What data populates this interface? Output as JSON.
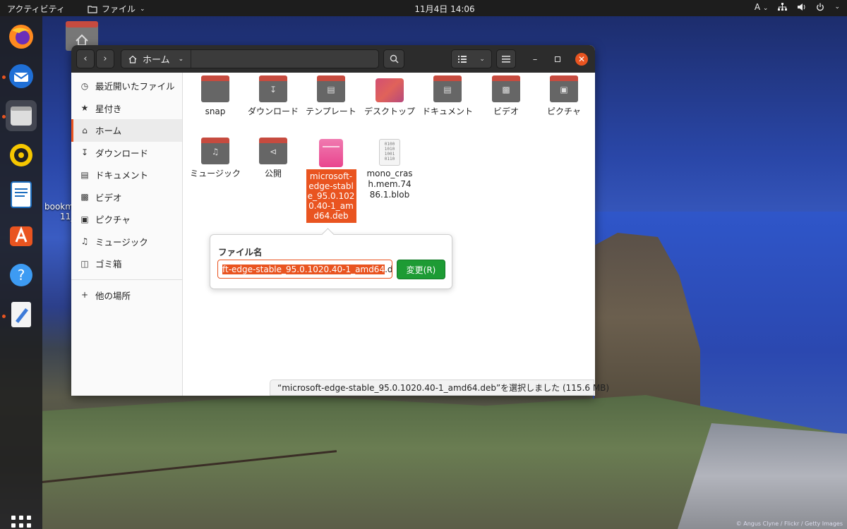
{
  "topbar": {
    "activities": "アクティビティ",
    "app_name": "ファイル",
    "clock": "11月4日  14:06",
    "input_method": "A"
  },
  "desktop": {
    "label_line1": "bookm",
    "label_line2": "11_",
    "credit": "© Angus Clyne / Flickr / Getty Images"
  },
  "window": {
    "path_home": "ホーム",
    "status": "“microsoft-edge-stable_95.0.1020.40-1_amd64.deb”を選択しました (115.6 MB)"
  },
  "sidebar": {
    "items": [
      {
        "label": "最近開いたファイル",
        "icon": "clock-icon"
      },
      {
        "label": "星付き",
        "icon": "star-icon"
      },
      {
        "label": "ホーム",
        "icon": "home-icon"
      },
      {
        "label": "ダウンロード",
        "icon": "download-icon"
      },
      {
        "label": "ドキュメント",
        "icon": "document-icon"
      },
      {
        "label": "ビデオ",
        "icon": "video-icon"
      },
      {
        "label": "ピクチャ",
        "icon": "picture-icon"
      },
      {
        "label": "ミュージック",
        "icon": "music-icon"
      },
      {
        "label": "ゴミ箱",
        "icon": "trash-icon"
      }
    ],
    "other_places": "他の場所"
  },
  "files": [
    {
      "name": "snap",
      "icon": "folder-icon"
    },
    {
      "name": "ダウンロード",
      "icon": "download-folder-icon"
    },
    {
      "name": "テンプレート",
      "icon": "template-folder-icon"
    },
    {
      "name": "デスクトップ",
      "icon": "desktop-folder-icon"
    },
    {
      "name": "ドキュメント",
      "icon": "document-folder-icon"
    },
    {
      "name": "ビデオ",
      "icon": "video-folder-icon"
    },
    {
      "name": "ピクチャ",
      "icon": "picture-folder-icon"
    },
    {
      "name": "ミュージック",
      "icon": "music-folder-icon"
    },
    {
      "name": "公開",
      "icon": "share-folder-icon"
    },
    {
      "name": "microsoft-edge-stable_95.0.1020.40-1_amd64.deb",
      "icon": "deb-package-icon",
      "selected": true
    },
    {
      "name": "mono_crash.mem.7486.1.blob",
      "icon": "binary-file-icon"
    }
  ],
  "rename": {
    "title": "ファイル名",
    "selected_text": "ft-edge-stable_95.0.1020.40-1_amd64",
    "extension": ".deb",
    "button": "変更(R)"
  },
  "colors": {
    "accent": "#e95420",
    "confirm": "#1d9b34",
    "headerbar": "#2c2c2c",
    "topbar": "#1d1d1d"
  }
}
